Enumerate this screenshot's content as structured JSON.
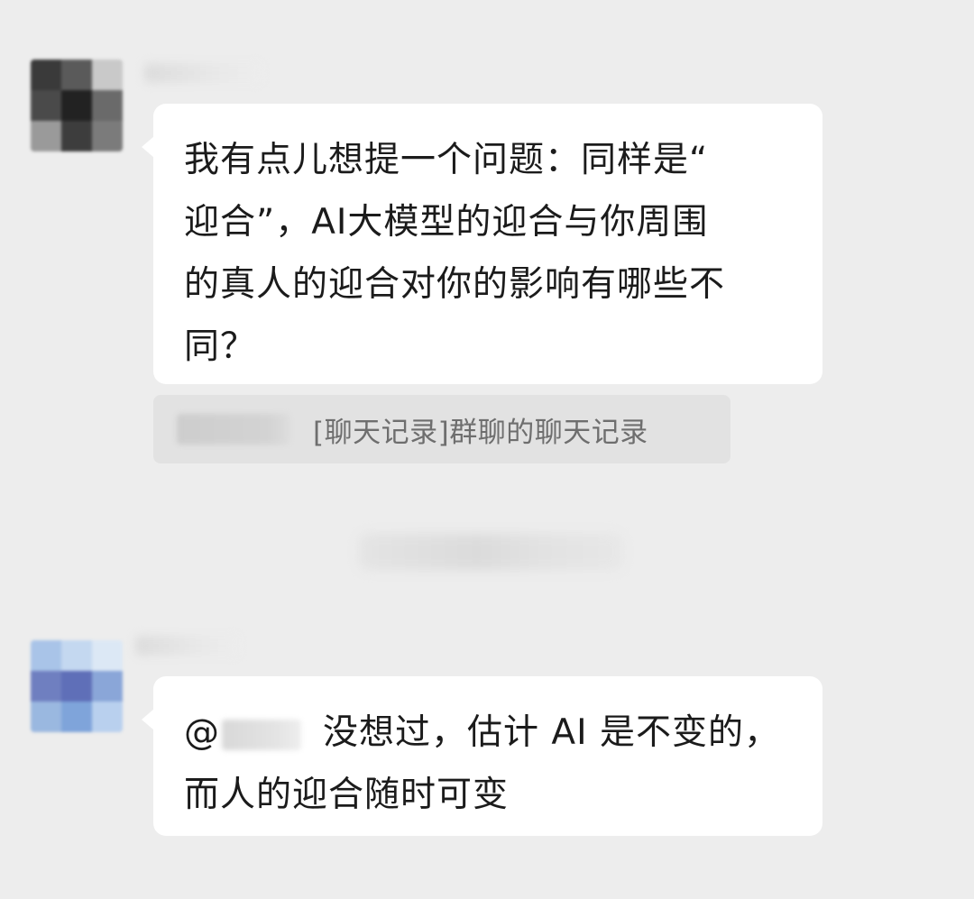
{
  "messages": [
    {
      "text_lines": [
        "我有点儿想提一个问题：同样是“",
        "迎合”，AI大模型的迎合与你周围",
        "的真人的迎合对你的影响有哪些不",
        "同？"
      ],
      "quote_label": "[聊天记录]群聊的聊天记录"
    },
    {
      "at_symbol": "@",
      "text_line1": "没想过，估计 AI 是不变的，",
      "text_line2": "而人的迎合随时可变"
    }
  ],
  "colors": {
    "background": "#ededed",
    "bubble": "#ffffff",
    "quote_bg": "#e2e2e2",
    "text": "#1b1b1b",
    "quote_text": "#6e6e6e"
  }
}
